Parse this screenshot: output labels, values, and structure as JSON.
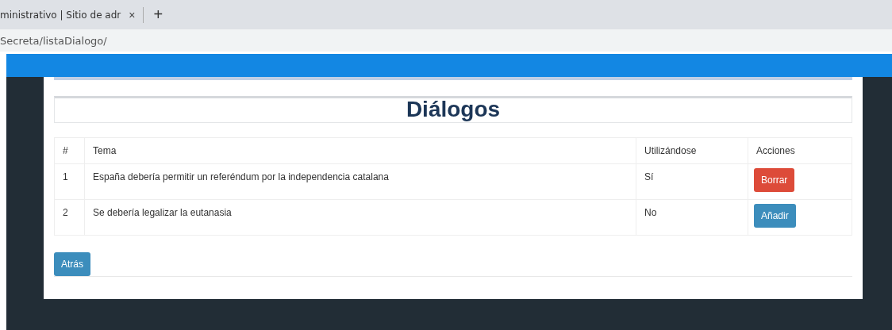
{
  "browser": {
    "tab_title": "ministrativo | Sitio de adr",
    "tab_close": "×",
    "new_tab": "+",
    "address": "Secreta/listaDialogo/"
  },
  "page": {
    "title": "Diálogos",
    "table": {
      "columns": [
        "#",
        "Tema",
        "Utilizándose",
        "Acciones"
      ],
      "rows": [
        {
          "number": "1",
          "topic": "España debería permitir un referéndum por la independencia catalana",
          "in_use": "Sí",
          "action": {
            "label": "Borrar",
            "kind": "danger"
          }
        },
        {
          "number": "2",
          "topic": "Se debería legalizar la eutanasia",
          "in_use": "No",
          "action": {
            "label": "Añadir",
            "kind": "primary"
          }
        }
      ]
    },
    "back_button": "Atrás"
  }
}
